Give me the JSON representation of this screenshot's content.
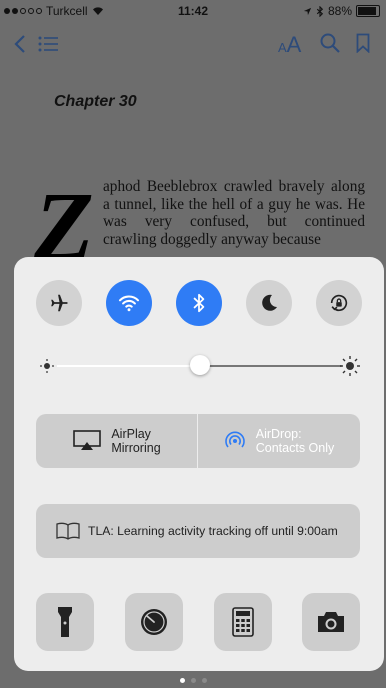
{
  "status_bar": {
    "carrier": "Turkcell",
    "time": "11:42",
    "battery": "88%",
    "battery_level": 0.88
  },
  "nav": {
    "icons": [
      "back-icon",
      "list-icon",
      "font-size-icon",
      "search-icon",
      "bookmark-icon"
    ],
    "font_label": "AA"
  },
  "book": {
    "chapter": "Chapter 30",
    "drop_cap": "Z",
    "text": "aphod Beeblebrox crawled bravely along a tunnel, like the hell of a guy he was. He was very confused, but continued crawling doggedly anyway because"
  },
  "control_center": {
    "toggles": [
      {
        "name": "airplane-mode",
        "icon": "airplane-icon",
        "on": false
      },
      {
        "name": "wifi",
        "icon": "wifi-icon",
        "on": true
      },
      {
        "name": "bluetooth",
        "icon": "bluetooth-icon",
        "on": true
      },
      {
        "name": "do-not-disturb",
        "icon": "moon-icon",
        "on": false
      },
      {
        "name": "rotation-lock",
        "icon": "rotation-lock-icon",
        "on": false
      }
    ],
    "brightness": 0.5,
    "airplay": {
      "line1": "AirPlay",
      "line2": "Mirroring"
    },
    "airdrop": {
      "line1": "AirDrop:",
      "line2": "Contacts Only"
    },
    "tla_text": "TLA: Learning activity tracking off until 9:00am",
    "tools": [
      "flashlight-icon",
      "timer-icon",
      "calculator-icon",
      "camera-icon"
    ],
    "accent_color": "#2f7cf5"
  },
  "pager": {
    "count": 3,
    "active": 0
  }
}
